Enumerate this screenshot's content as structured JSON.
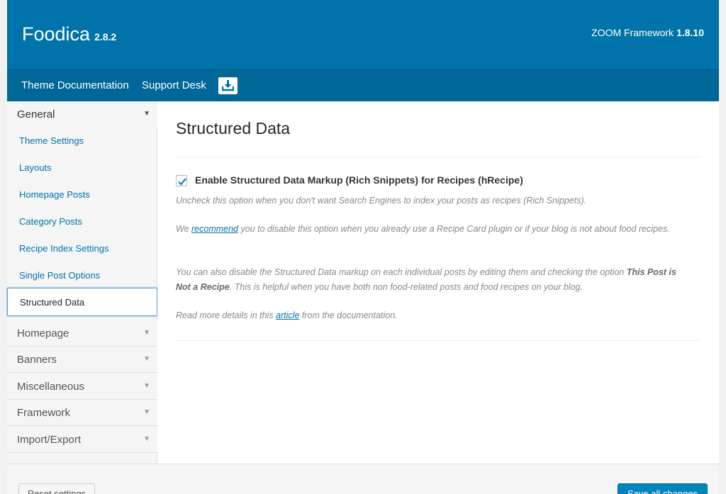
{
  "header": {
    "theme_name": "Foodica",
    "theme_version": "2.8.2",
    "framework_label": "ZOOM Framework",
    "framework_version": "1.8.10",
    "color": "#0073aa"
  },
  "subnav": {
    "doc_link": "Theme Documentation",
    "support_link": "Support Desk",
    "download_icon": "download-icon"
  },
  "sidebar": {
    "general": {
      "label": "General",
      "items": [
        "Theme Settings",
        "Layouts",
        "Homepage Posts",
        "Category Posts",
        "Recipe Index Settings",
        "Single Post Options",
        "Structured Data"
      ],
      "active": "Structured Data"
    },
    "sections": [
      "Homepage",
      "Banners",
      "Miscellaneous",
      "Framework",
      "Import/Export"
    ]
  },
  "main": {
    "title": "Structured Data",
    "checkbox_label": "Enable Structured Data Markup (Rich Snippets) for Recipes (hRecipe)",
    "checkbox_checked": true,
    "desc1": "Uncheck this option when you don't want Search Engines to index your posts as recipes (Rich Snippets).",
    "desc2_prefix": "We ",
    "desc2_link": "recommend",
    "desc2_suffix": " you to disable this option when you already use a Recipe Card plugin or if your blog is not about food recipes.",
    "desc3_prefix": "You can also disable the Structured Data markup on each individual posts by editing them and checking the option ",
    "desc3_bold": "This Post is Not a Recipe",
    "desc3_suffix": ". This is helpful when you have both non food-related posts and food recipes on your blog.",
    "desc4_prefix": "Read more details in this ",
    "desc4_link": "article",
    "desc4_suffix": " from the documentation."
  },
  "footer": {
    "reset_label": "Reset settings",
    "save_label": "Save all changes"
  }
}
